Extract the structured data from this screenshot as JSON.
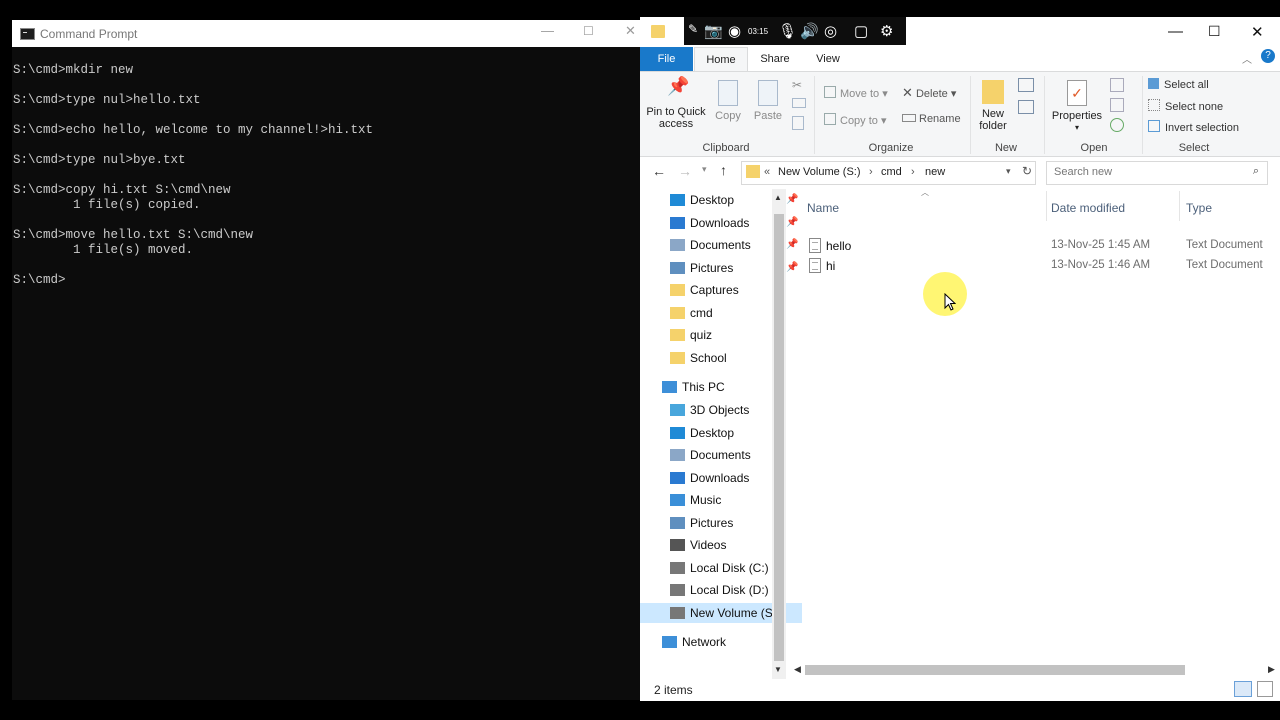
{
  "cmd": {
    "title": "Command Prompt",
    "lines": [
      "S:\\cmd>mkdir new",
      "",
      "S:\\cmd>type nul>hello.txt",
      "",
      "S:\\cmd>echo hello, welcome to my channel!>hi.txt",
      "",
      "S:\\cmd>type nul>bye.txt",
      "",
      "S:\\cmd>copy hi.txt S:\\cmd\\new",
      "        1 file(s) copied.",
      "",
      "S:\\cmd>move hello.txt S:\\cmd\\new",
      "        1 file(s) moved.",
      "",
      "S:\\cmd>"
    ]
  },
  "recorder": {
    "time": "03:15"
  },
  "explorer": {
    "tabs": {
      "file": "File",
      "home": "Home",
      "share": "Share",
      "view": "View"
    },
    "ribbon": {
      "clipboard": {
        "label": "Clipboard",
        "pin": "Pin to Quick",
        "pin2": "access",
        "copy": "Copy",
        "paste": "Paste"
      },
      "organize": {
        "label": "Organize",
        "move_to": "Move to",
        "copy_to": "Copy to",
        "delete": "Delete",
        "rename": "Rename"
      },
      "new": {
        "label": "New",
        "new_folder": "New",
        "new_folder2": "folder"
      },
      "open": {
        "label": "Open",
        "properties": "Properties"
      },
      "select": {
        "label": "Select",
        "select_all": "Select all",
        "select_none": "Select none",
        "invert": "Invert selection"
      }
    },
    "address": {
      "prefix": "«",
      "crumbs": [
        "New Volume (S:)",
        "cmd",
        "new"
      ]
    },
    "search": {
      "placeholder": "Search new"
    },
    "nav": {
      "quick": [
        {
          "label": "Desktop",
          "icon": "desktop-icon",
          "color": "#1f8ad6"
        },
        {
          "label": "Downloads",
          "icon": "download-arrow-icon",
          "color": "#2a7ad1"
        },
        {
          "label": "Documents",
          "icon": "documents-icon",
          "color": "#8ba7c7"
        },
        {
          "label": "Pictures",
          "icon": "pictures-icon",
          "color": "#5f8fbf"
        },
        {
          "label": "Captures",
          "icon": "folder-icon",
          "color": "#f5d26b"
        },
        {
          "label": "cmd",
          "icon": "folder-icon",
          "color": "#f5d26b"
        },
        {
          "label": "quiz",
          "icon": "folder-icon",
          "color": "#f5d26b"
        },
        {
          "label": "School",
          "icon": "folder-icon",
          "color": "#f5d26b"
        }
      ],
      "this_pc": "This PC",
      "pc": [
        {
          "label": "3D Objects",
          "icon": "cube-icon",
          "color": "#48a6dc"
        },
        {
          "label": "Desktop",
          "icon": "desktop-icon",
          "color": "#1f8ad6"
        },
        {
          "label": "Documents",
          "icon": "documents-icon",
          "color": "#8ba7c7"
        },
        {
          "label": "Downloads",
          "icon": "download-arrow-icon",
          "color": "#2a7ad1"
        },
        {
          "label": "Music",
          "icon": "music-icon",
          "color": "#3a8fd8"
        },
        {
          "label": "Pictures",
          "icon": "pictures-icon",
          "color": "#5f8fbf"
        },
        {
          "label": "Videos",
          "icon": "videos-icon",
          "color": "#555"
        },
        {
          "label": "Local Disk (C:)",
          "icon": "drive-icon",
          "color": "#777"
        },
        {
          "label": "Local Disk (D:)",
          "icon": "drive-icon",
          "color": "#777"
        },
        {
          "label": "New Volume (S:)",
          "icon": "drive-icon",
          "color": "#777"
        }
      ],
      "network": "Network"
    },
    "columns": {
      "name": "Name",
      "date": "Date modified",
      "type": "Type"
    },
    "files": [
      {
        "name": "hello",
        "date": "13-Nov-25 1:45 AM",
        "type": "Text Document"
      },
      {
        "name": "hi",
        "date": "13-Nov-25 1:46 AM",
        "type": "Text Document"
      }
    ],
    "status": "2 items"
  }
}
